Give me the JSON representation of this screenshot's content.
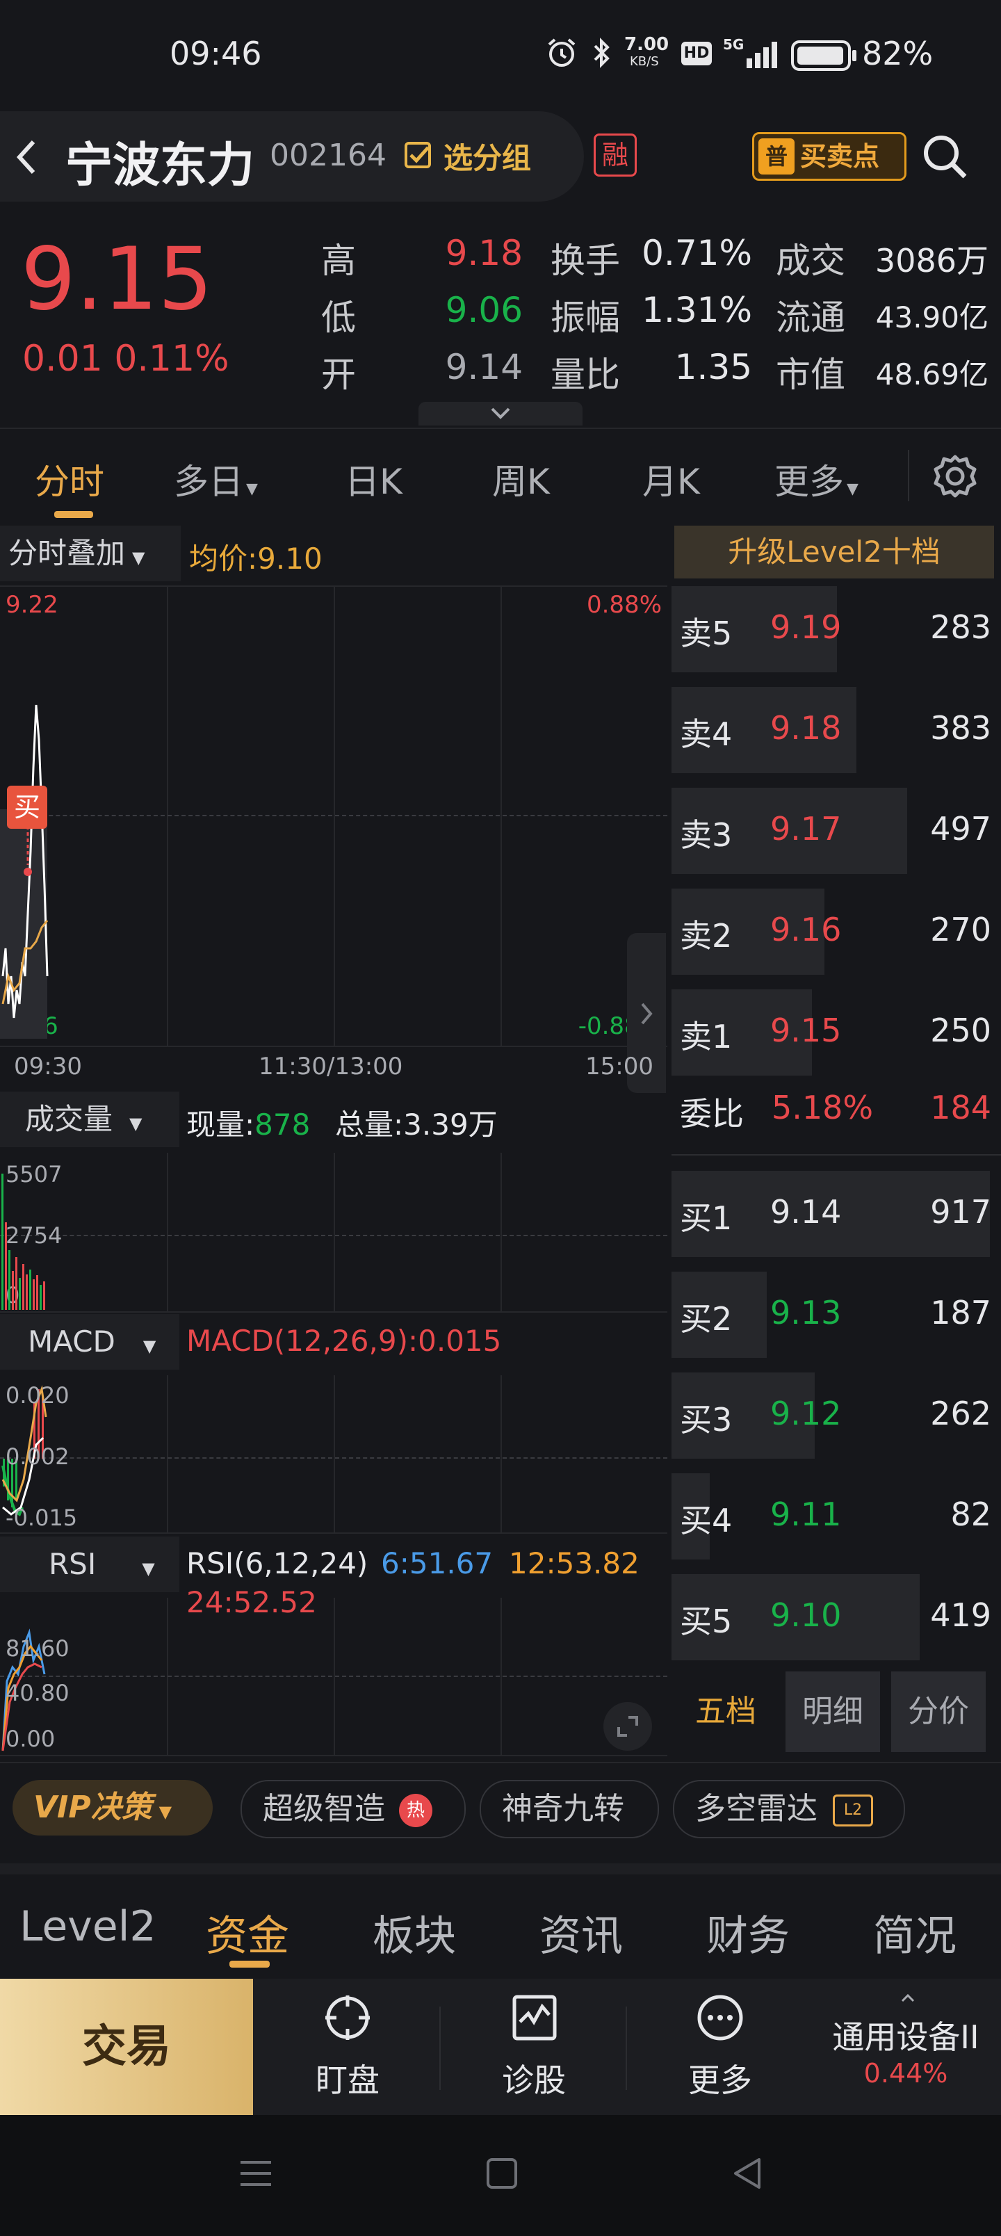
{
  "status_bar": {
    "time": "09:46",
    "net_speed_top": "7.00",
    "net_speed_unit": "KB/S",
    "hd": "HD",
    "signal": "5G",
    "battery": "82%"
  },
  "header": {
    "back_icon": "chevron-left-icon",
    "stock_name": "宁波东力",
    "stock_code": "002164",
    "group_label": "选分组",
    "margin_badge": "融",
    "buysell_badge": "普",
    "buysell_label": "买卖点",
    "search_icon": "search-icon"
  },
  "quote": {
    "price": "9.15",
    "change": "0.01",
    "change_pct": "0.11%",
    "rows": [
      {
        "l1": "高",
        "v1": "9.18",
        "l2": "换手",
        "v2": "0.71%",
        "l3": "成交",
        "v3": "3086万"
      },
      {
        "l1": "低",
        "v1": "9.06",
        "l2": "振幅",
        "v2": "1.31%",
        "l3": "流通",
        "v3": "43.90亿"
      },
      {
        "l1": "开",
        "v1": "9.14",
        "l2": "量比",
        "v2": "1.35",
        "l3": "市值",
        "v3": "48.69亿"
      }
    ]
  },
  "tabs": {
    "items": [
      "分时",
      "多日",
      "日K",
      "周K",
      "月K",
      "更多"
    ],
    "active": "分时",
    "settings_icon": "gear-icon"
  },
  "intraday": {
    "overlay_label": "分时叠加",
    "avg_label": "均价:",
    "avg_value": "9.10",
    "high_price": "9.22",
    "low_price": "9.06",
    "high_pct": "0.88%",
    "low_pct": "-0.88%",
    "buy_marker": "买",
    "time_start": "09:30",
    "time_mid": "11:30/13:00",
    "time_end": "15:00"
  },
  "volume": {
    "label": "成交量",
    "now_label": "现量:",
    "now_value": "878",
    "total_label": "总量:",
    "total_value": "3.39万",
    "axis": [
      "5507",
      "2754",
      "0"
    ]
  },
  "macd": {
    "label": "MACD",
    "value": "MACD(12,26,9):0.015",
    "axis": [
      "0.020",
      "0.002",
      "-0.015"
    ]
  },
  "rsi": {
    "label": "RSI",
    "title": "RSI(6,12,24)",
    "rsi6": "6:51.67",
    "rsi12": "12:53.82",
    "rsi24": "24:52.52",
    "axis": [
      "81.60",
      "40.80",
      "0.00"
    ]
  },
  "order_book": {
    "upgrade_label": "升级Level2十档",
    "sells": [
      {
        "label": "卖5",
        "price": "9.19",
        "vol": "283",
        "fill": 0.52
      },
      {
        "label": "卖4",
        "price": "9.18",
        "vol": "383",
        "fill": 0.58
      },
      {
        "label": "卖3",
        "price": "9.17",
        "vol": "497",
        "fill": 0.74
      },
      {
        "label": "卖2",
        "price": "9.16",
        "vol": "270",
        "fill": 0.48
      },
      {
        "label": "卖1",
        "price": "9.15",
        "vol": "250",
        "fill": 0.44
      }
    ],
    "ratio_label": "委比",
    "ratio_pct": "5.18%",
    "ratio_value": "184",
    "buys": [
      {
        "label": "买1",
        "price": "9.14",
        "vol": "917",
        "fill": 1.0
      },
      {
        "label": "买2",
        "price": "9.13",
        "vol": "187",
        "fill": 0.3
      },
      {
        "label": "买3",
        "price": "9.12",
        "vol": "262",
        "fill": 0.45
      },
      {
        "label": "买4",
        "price": "9.11",
        "vol": "82",
        "fill": 0.12
      },
      {
        "label": "买5",
        "price": "9.10",
        "vol": "419",
        "fill": 0.78
      }
    ],
    "sub_tabs": [
      "五档",
      "明细",
      "分价"
    ],
    "sub_active": "五档"
  },
  "promo": {
    "vip": "VIP决策",
    "items": [
      "超级智造",
      "神奇九转",
      "多空雷达"
    ],
    "hot": "热",
    "l2": "L2"
  },
  "bottom_tabs": {
    "items": [
      "Level2",
      "资金",
      "板块",
      "资讯",
      "财务",
      "简况"
    ],
    "active": "资金"
  },
  "action_bar": {
    "trade": "交易",
    "watch": "盯盘",
    "diagnose": "诊股",
    "more": "更多",
    "sector_name": "通用设备II",
    "sector_change": "0.44%"
  },
  "colors": {
    "up": "#e8494c",
    "down": "#19b24a",
    "accent": "#e9a94a",
    "bg": "#16171b"
  }
}
